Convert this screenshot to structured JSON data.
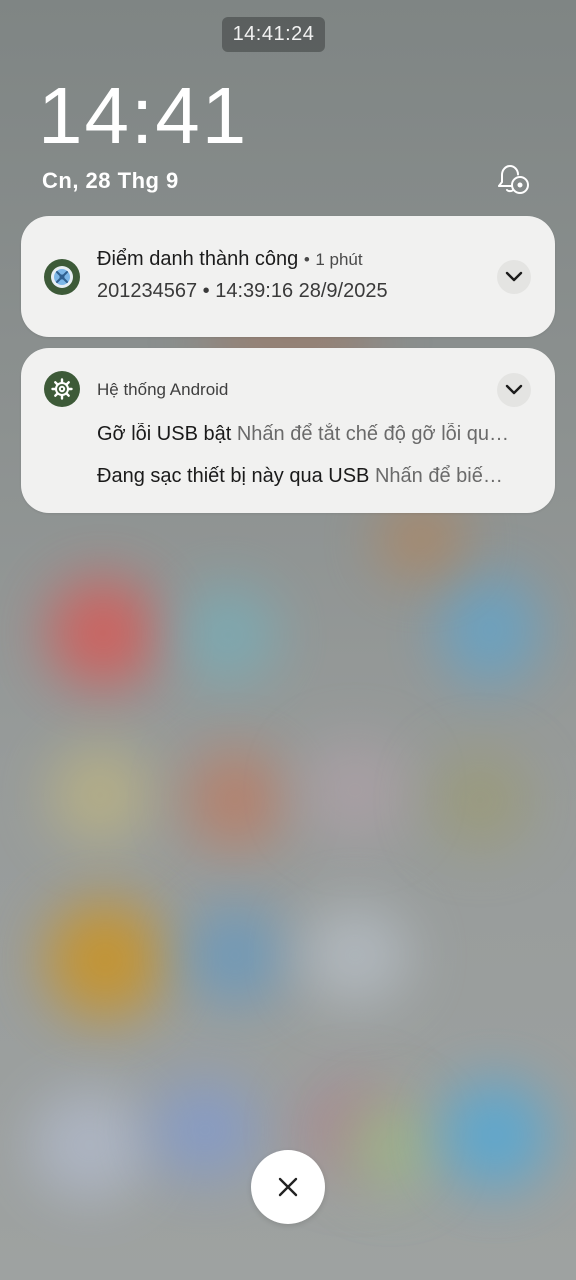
{
  "status": {
    "time_chip": "14:41:24"
  },
  "lockscreen": {
    "time": "14:41",
    "date": "Cn, 28 Thg 9"
  },
  "notifications": [
    {
      "title": "Điểm danh thành công",
      "separator": "•",
      "time_ago": "1 phút",
      "body": "201234567 • 14:39:16 28/9/2025",
      "icon": "checkin-app-icon"
    },
    {
      "app_name": "Hệ thống Android",
      "icon": "android-system-icon",
      "items": [
        {
          "title": "Gỡ lỗi USB bật",
          "desc": "Nhấn để tắt chế độ gỡ lỗi qu…"
        },
        {
          "title": "Đang sạc thiết bị này qua USB",
          "desc": "Nhấn để biế…"
        }
      ]
    }
  ],
  "icons": {
    "notification_settings": "bell-settings-icon",
    "expand": "chevron-down-icon",
    "close": "close-icon"
  }
}
